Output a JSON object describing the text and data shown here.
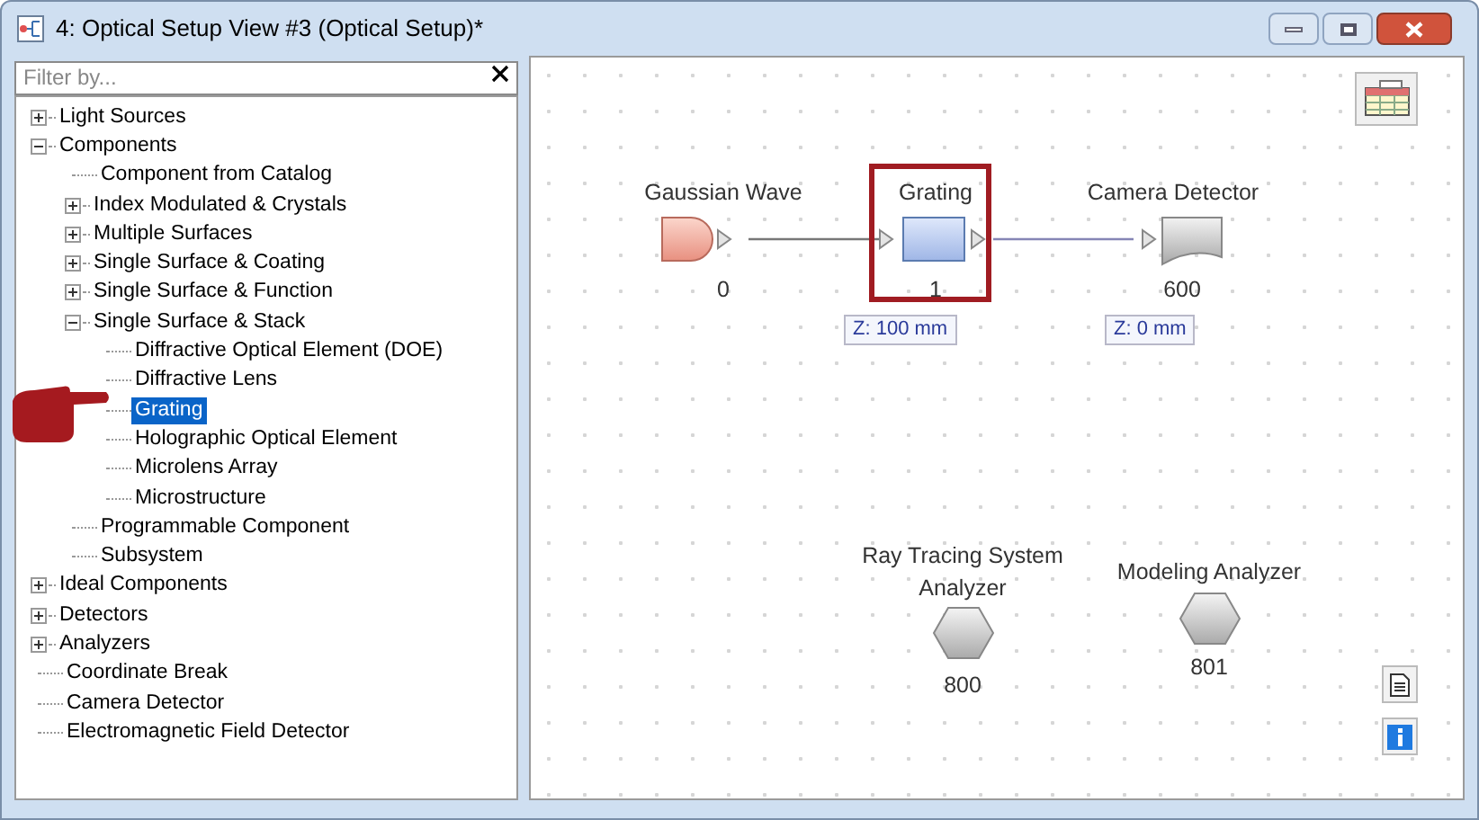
{
  "window": {
    "title": "4: Optical Setup View #3 (Optical Setup)*"
  },
  "filter": {
    "placeholder": "Filter by..."
  },
  "tree": [
    {
      "label": "Light Sources",
      "kind": "group",
      "expanded": false,
      "selected": false
    },
    {
      "label": "Components",
      "kind": "group",
      "expanded": true,
      "selected": false,
      "children": [
        {
          "label": "Component from Catalog",
          "kind": "leaf",
          "selected": false
        },
        {
          "label": "Index Modulated & Crystals",
          "kind": "group",
          "expanded": false,
          "selected": false
        },
        {
          "label": "Multiple Surfaces",
          "kind": "group",
          "expanded": false,
          "selected": false
        },
        {
          "label": "Single Surface & Coating",
          "kind": "group",
          "expanded": false,
          "selected": false
        },
        {
          "label": "Single Surface & Function",
          "kind": "group",
          "expanded": false,
          "selected": false
        },
        {
          "label": "Single Surface & Stack",
          "kind": "group",
          "expanded": true,
          "selected": false,
          "children": [
            {
              "label": "Diffractive Optical Element (DOE)",
              "kind": "leaf",
              "selected": false
            },
            {
              "label": "Diffractive Lens",
              "kind": "leaf",
              "selected": false
            },
            {
              "label": "Grating",
              "kind": "leaf",
              "selected": true
            },
            {
              "label": "Holographic Optical Element",
              "kind": "leaf",
              "selected": false
            },
            {
              "label": "Microlens Array",
              "kind": "leaf",
              "selected": false
            },
            {
              "label": "Microstructure",
              "kind": "leaf",
              "selected": false
            }
          ]
        },
        {
          "label": "Programmable Component",
          "kind": "leaf",
          "selected": false
        },
        {
          "label": "Subsystem",
          "kind": "leaf",
          "selected": false
        }
      ]
    },
    {
      "label": "Ideal Components",
      "kind": "group",
      "expanded": false,
      "selected": false
    },
    {
      "label": "Detectors",
      "kind": "group",
      "expanded": false,
      "selected": false
    },
    {
      "label": "Analyzers",
      "kind": "group",
      "expanded": false,
      "selected": false
    },
    {
      "label": "Coordinate Break",
      "kind": "leaf",
      "selected": false
    },
    {
      "label": "Camera Detector",
      "kind": "leaf",
      "selected": false
    },
    {
      "label": "Electromagnetic Field Detector",
      "kind": "leaf",
      "selected": false
    }
  ],
  "nodes": [
    {
      "label": "Gaussian Wave",
      "number": "0",
      "kind": "source",
      "highlighted": false
    },
    {
      "label": "Grating",
      "number": "1",
      "kind": "component",
      "highlighted": true,
      "z": "Z: 100 mm"
    },
    {
      "label": "Camera Detector",
      "number": "600",
      "kind": "detector",
      "highlighted": false,
      "z": "Z: 0 mm"
    },
    {
      "label": "Ray Tracing System Analyzer",
      "number": "800",
      "kind": "analyzer",
      "highlighted": false
    },
    {
      "label": "Modeling Analyzer",
      "number": "801",
      "kind": "analyzer",
      "highlighted": false
    }
  ]
}
